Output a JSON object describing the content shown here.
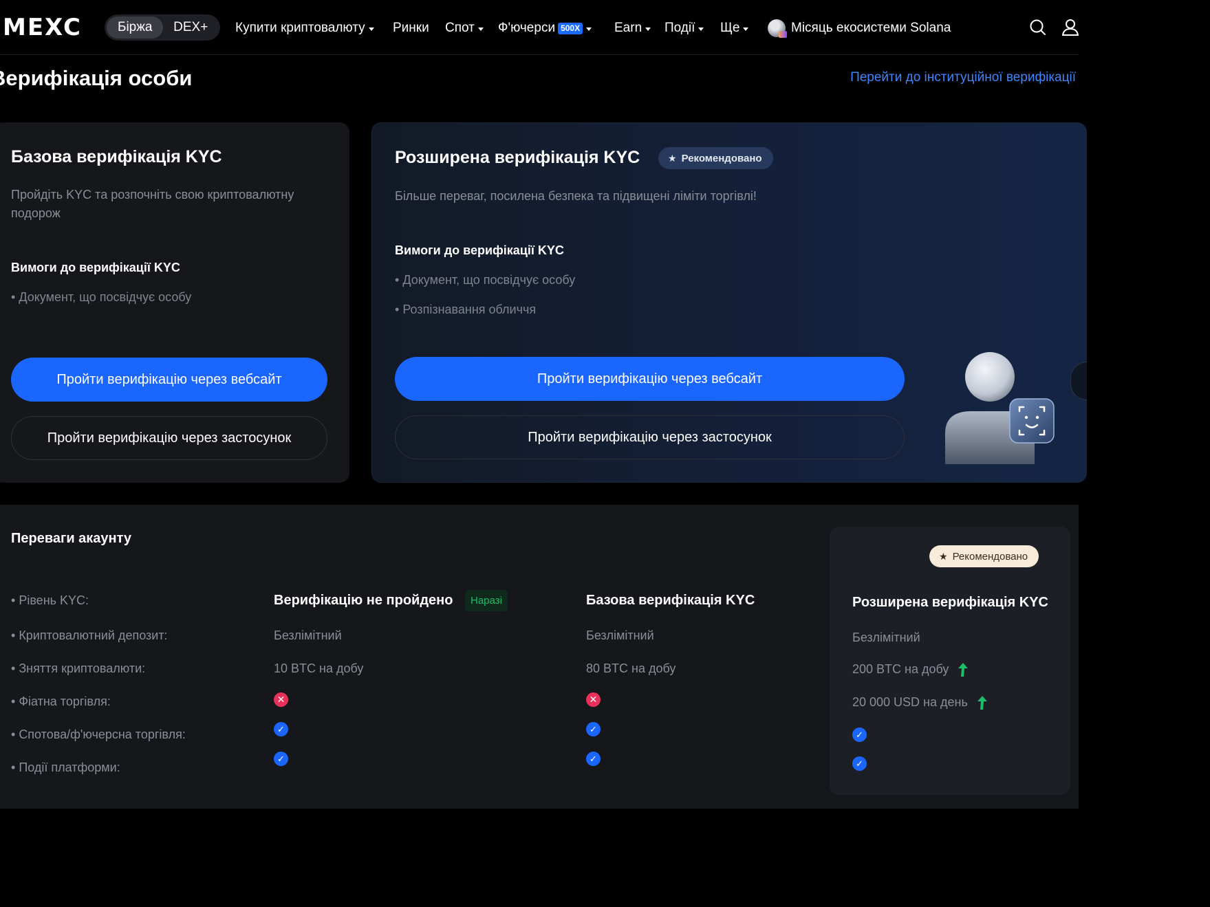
{
  "nav": {
    "logo": "MEXC",
    "mode_options": [
      "Біржа",
      "DEX+"
    ],
    "items": [
      {
        "label": "Купити криптовалюту",
        "dropdown": true
      },
      {
        "label": "Ринки",
        "dropdown": false
      },
      {
        "label": "Спот",
        "dropdown": true
      },
      {
        "label": "Ф'ючерси",
        "badge": "500X",
        "dropdown": true
      },
      {
        "label": "Earn",
        "dropdown": true
      },
      {
        "label": "Події",
        "dropdown": true
      },
      {
        "label": "Ще",
        "dropdown": true
      }
    ],
    "promo": "Місяць екосистеми Solana",
    "icons": [
      "search-icon",
      "user-icon"
    ]
  },
  "header": {
    "title": "Верифікація особи",
    "institutional_link": "Перейти до інституційної верифікації"
  },
  "basic_card": {
    "title": "Базова верифікація KYC",
    "desc": "Пройдіть KYC та розпочніть свою криптовалютну подорож",
    "req_title": "Вимоги до верифікації KYC",
    "requirements": [
      "Документ, що посвідчує особу"
    ],
    "web_button": "Пройти верифікацію через вебсайт",
    "app_button": "Пройти верифікацію через застосунок"
  },
  "advanced_card": {
    "title": "Розширена верифікація KYC",
    "badge": "Рекомендовано",
    "desc": "Більше переваг, посилена безпека та підвищені ліміти торгівлі!",
    "req_title": "Вимоги до верифікації KYC",
    "requirements": [
      "Документ, що посвідчує особу",
      "Розпізнавання обличчя"
    ],
    "web_button": "Пройти верифікацію через вебсайт",
    "app_button": "Пройти верифікацію через застосунок"
  },
  "benefits": {
    "title": "Переваги акаунту",
    "row_labels": [
      "Рівень KYC:",
      "Криптовалютний депозит:",
      "Зняття криптовалюти:",
      "Фіатна торгівля:",
      "Спотова/ф'ючерсна торгівля:",
      "Події платформи:"
    ],
    "current": {
      "head": "Верифікацію не пройдено",
      "badge": "Наразі",
      "deposit": "Безлімітний",
      "withdraw": "10 BTC на добу",
      "fiat": "no",
      "spot_futures": "yes",
      "events": "yes"
    },
    "basic": {
      "head": "Базова верифікація KYC",
      "deposit": "Безлімітний",
      "withdraw": "80 BTC на добу",
      "fiat": "no",
      "spot_futures": "yes",
      "events": "yes"
    },
    "advanced": {
      "badge": "Рекомендовано",
      "head": "Розширена верифікація KYC",
      "deposit": "Безлімітний",
      "withdraw": "200 BTC на добу",
      "fiat": "20 000 USD на день",
      "spot_futures": "yes",
      "events": "yes"
    }
  },
  "colors": {
    "accent": "#1a66ff",
    "link": "#3d86ff",
    "success": "#1cbf67",
    "danger": "#e8315a"
  }
}
